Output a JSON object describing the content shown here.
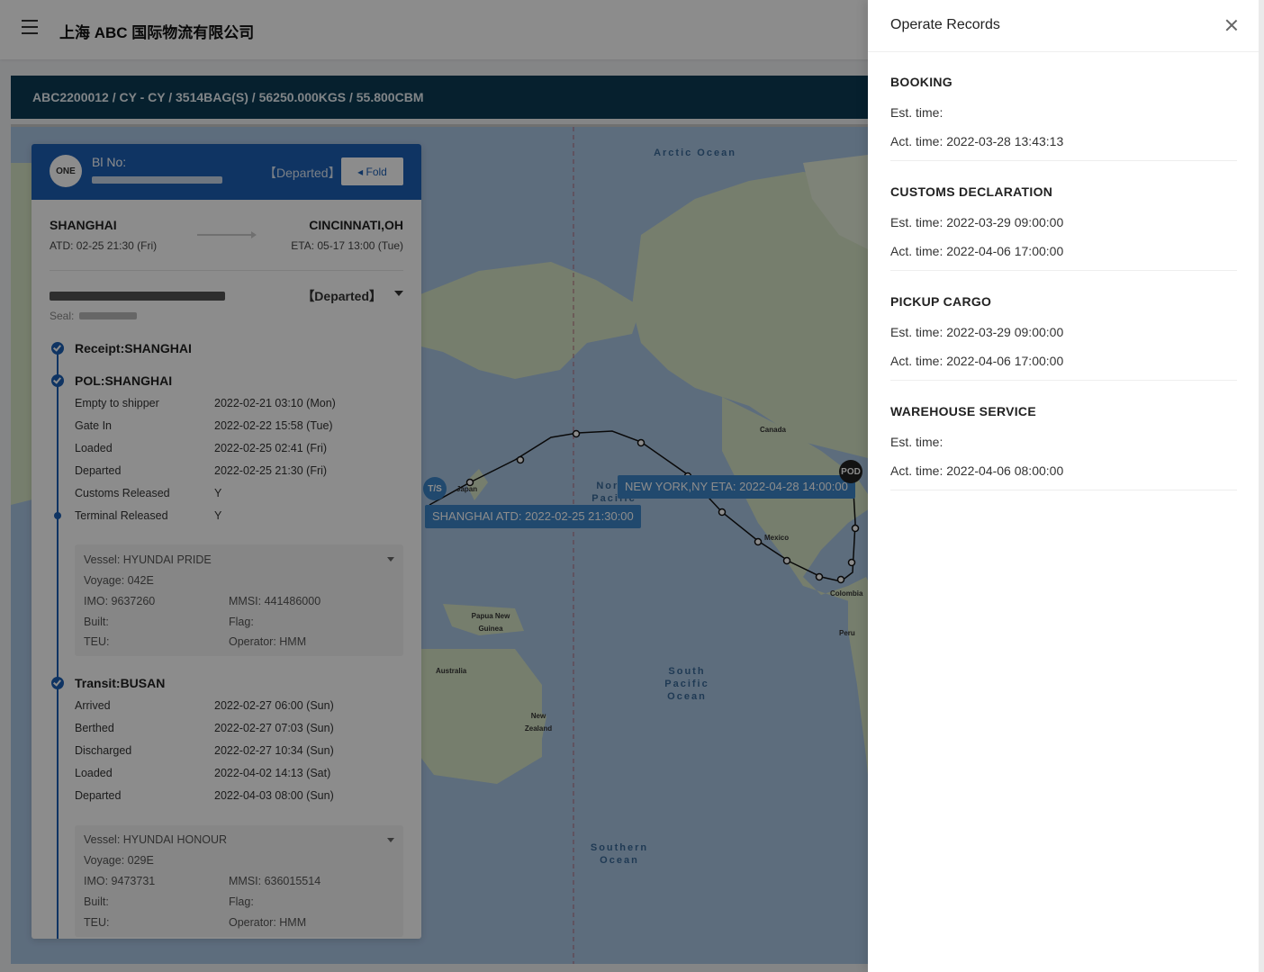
{
  "header": {
    "company": "上海 ABC 国际物流有限公司"
  },
  "shipment_summary": "ABC2200012 / CY - CY / 3514BAG(S) / 56250.000KGS / 55.800CBM",
  "map": {
    "ocean_labels": {
      "arctic": "Arctic Ocean",
      "north_pacific": "North Pacific Ocean",
      "south_pacific": "South Pacific Ocean",
      "southern": "Southern Ocean"
    },
    "place_labels": [
      "Japan",
      "Canada",
      "Mexico",
      "Colombia",
      "Peru",
      "Papua New Guinea",
      "Australia",
      "New Zealand"
    ],
    "tooltip_pod": "NEW YORK,NY   ETA: 2022-04-28 14:00:00",
    "tooltip_pol": "SHANGHAI   ATD: 2022-02-25 21:30:00",
    "pin_pod": "POD",
    "pin_ts": "T/S"
  },
  "card": {
    "logo": "ONE",
    "bl_label": "Bl No:",
    "head_status": "【Departed】",
    "fold_label": "◂ Fold",
    "origin": "SHANGHAI",
    "atd": "ATD: 02-25 21:30 (Fri)",
    "destination": "CINCINNATI,OH",
    "eta": "ETA: 05-17 13:00 (Tue)",
    "container_status": "【Departed】",
    "seal_label": "Seal:",
    "stages": [
      {
        "title": "Receipt:SHANGHAI"
      },
      {
        "title": "POL:SHANGHAI",
        "events": [
          {
            "name": "Empty to shipper",
            "value": "2022-02-21 03:10 (Mon)"
          },
          {
            "name": "Gate In",
            "value": "2022-02-22 15:58 (Tue)"
          },
          {
            "name": "Loaded",
            "value": "2022-02-25 02:41 (Fri)"
          },
          {
            "name": "Departed",
            "value": "2022-02-25 21:30 (Fri)"
          },
          {
            "name": "Customs Released",
            "value": "Y"
          },
          {
            "name": "Terminal Released",
            "value": "Y"
          }
        ],
        "vessel": {
          "vessel": "Vessel: HYUNDAI PRIDE",
          "voyage": "Voyage: 042E",
          "imo": "IMO: 9637260",
          "mmsi": "MMSI: 441486000",
          "built": "Built:",
          "flag": "Flag:",
          "teu": "TEU:",
          "operator": "Operator: HMM"
        }
      },
      {
        "title": "Transit:BUSAN",
        "events": [
          {
            "name": "Arrived",
            "value": "2022-02-27 06:00 (Sun)"
          },
          {
            "name": "Berthed",
            "value": "2022-02-27 07:03 (Sun)"
          },
          {
            "name": "Discharged",
            "value": "2022-02-27 10:34 (Sun)"
          },
          {
            "name": "Loaded",
            "value": "2022-04-02 14:13 (Sat)"
          },
          {
            "name": "Departed",
            "value": "2022-04-03 08:00 (Sun)"
          }
        ],
        "vessel": {
          "vessel": "Vessel: HYUNDAI HONOUR",
          "voyage": "Voyage: 029E",
          "imo": "IMO: 9473731",
          "mmsi": "MMSI: 636015514",
          "built": "Built:",
          "flag": "Flag:",
          "teu": "TEU:",
          "operator": "Operator: HMM"
        }
      }
    ]
  },
  "drawer": {
    "title": "Operate Records",
    "records": [
      {
        "title": "BOOKING",
        "est": "Est. time:",
        "act": "Act. time: 2022-03-28 13:43:13"
      },
      {
        "title": "CUSTOMS DECLARATION",
        "est": "Est. time: 2022-03-29 09:00:00",
        "act": "Act. time: 2022-04-06 17:00:00"
      },
      {
        "title": "PICKUP CARGO",
        "est": "Est. time: 2022-03-29 09:00:00",
        "act": "Act. time: 2022-04-06 17:00:00"
      },
      {
        "title": "WAREHOUSE SERVICE",
        "est": "Est. time:",
        "act": "Act. time: 2022-04-06 08:00:00"
      }
    ]
  },
  "colors": {
    "brand_blue": "#1d5fb4",
    "summary_bar": "#0b3b55",
    "ocean": "#aac6e4",
    "land": "#d8e6c6"
  }
}
